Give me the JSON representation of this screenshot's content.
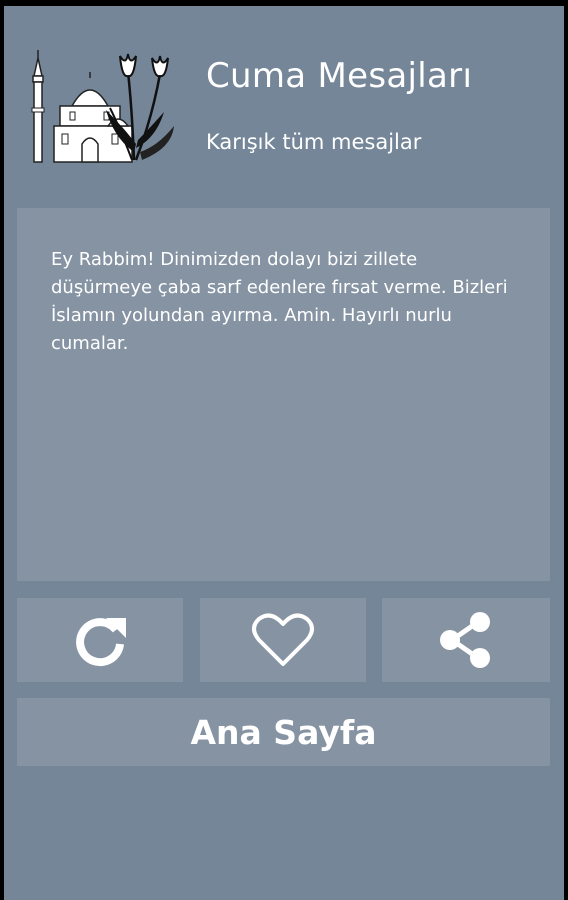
{
  "header": {
    "title": "Cuma Mesajları",
    "subtitle": "Karışık tüm mesajlar",
    "logo_icon": "mosque-tulip-logo"
  },
  "message": {
    "text": "Ey Rabbim! Dinimizden dolayı bizi zillete düşürmeye çaba sarf edenlere fırsat verme. Bizleri İslamın yolundan ayırma. Amin. Hayırlı nurlu cumalar."
  },
  "actions": {
    "refresh_icon": "refresh-icon",
    "favorite_icon": "heart-icon",
    "share_icon": "share-icon"
  },
  "home_button": {
    "label": "Ana Sayfa"
  },
  "colors": {
    "background": "#748698",
    "card": "#8593a3",
    "text": "#ffffff"
  }
}
